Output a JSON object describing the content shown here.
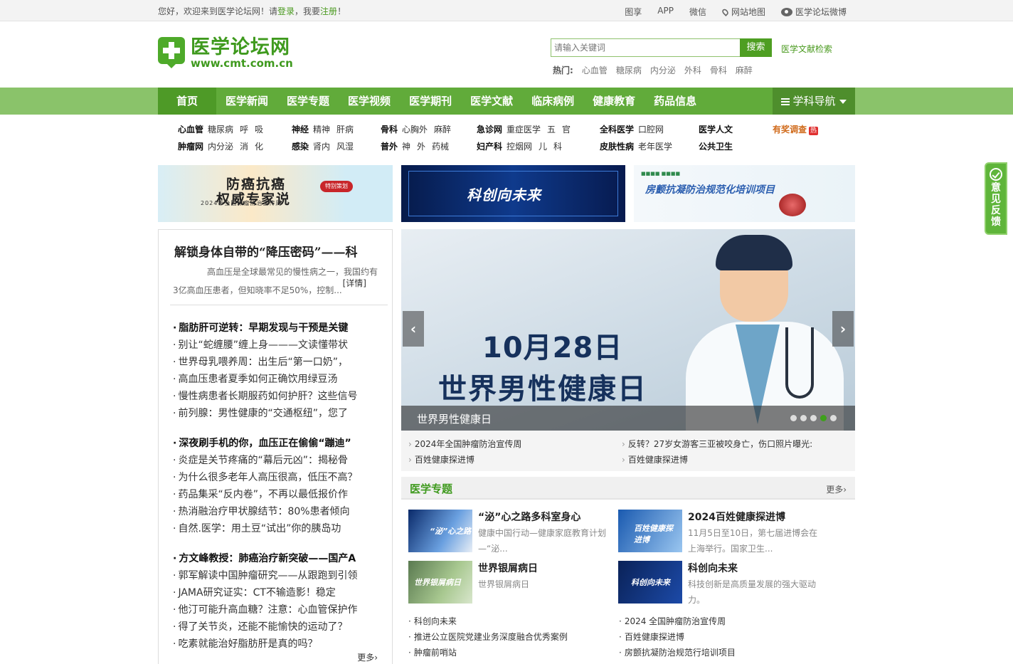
{
  "topbar": {
    "welcome_prefix": "您好，欢迎来到医学论坛网！请",
    "login": "登录",
    "mid": "，我要",
    "register": "注册",
    "suffix": "！",
    "links": [
      "图享",
      "APP",
      "微信",
      "网站地图",
      "医学论坛微博"
    ]
  },
  "header": {
    "logo_name": "医学论坛网",
    "logo_url": "www.cmt.com.cn",
    "search_placeholder": "请输入关键词",
    "search_button": "搜索",
    "literature_search": "医学文献检索",
    "hot_label": "热门:",
    "hot_terms": [
      "心血管",
      "糖尿病",
      "内分泌",
      "外科",
      "骨科",
      "麻醉"
    ]
  },
  "nav": {
    "items": [
      "首页",
      "医学新闻",
      "医学专题",
      "医学视频",
      "医学期刊",
      "医学文献",
      "临床病例",
      "健康教育",
      "药品信息"
    ],
    "subject_nav": "学科导航"
  },
  "categories": {
    "col1_row1": [
      "心血管",
      "糖尿病",
      "呼",
      "吸"
    ],
    "col1_row2": [
      "肿瘤网",
      "内分泌",
      "消",
      "化"
    ],
    "col2_row1": [
      "神经",
      "精神",
      "肝病"
    ],
    "col2_row2": [
      "感染",
      "肾内",
      "风湿"
    ],
    "col3_row1": [
      "骨科",
      "心胸外",
      "麻醉"
    ],
    "col3_row2": [
      "普外",
      "神",
      "外",
      "药械"
    ],
    "col4_row1": [
      "急诊网",
      "重症医学",
      "五",
      "官"
    ],
    "col4_row2": [
      "妇产科",
      "控烟网",
      "儿",
      "科"
    ],
    "col5_row1": [
      "全科医学",
      "口腔网"
    ],
    "col5_row2": [
      "皮肤性病",
      "老年医学"
    ],
    "col6_row1": [
      "医学人文"
    ],
    "col6_row2": [
      "公共卫生"
    ],
    "survey": "有奖调查",
    "survey_badge": "热"
  },
  "banners": {
    "b1_line1": "防癌抗癌",
    "b1_line2": "权威专家说",
    "b1_tag": "特别策划",
    "b1_sub": "2024年全国肿瘤防治宣传周",
    "b2_title": "科创向未来",
    "b3_title": "房颤抗凝防治规范化培训项目"
  },
  "feature": {
    "title": "解锁身体自带的“降压密码”——科",
    "desc": "高血压是全球最常见的慢性病之一，我国约有3亿高血压患者，但知晓率不足50%，控制...",
    "detail": "[详情]"
  },
  "news_groups": [
    [
      "脂肪肝可逆转：早期发现与干预是关键",
      "别让“蛇缠腰”缠上身———文读懂带状",
      "世界母乳喂养周：出生后“第一口奶”，",
      "高血压患者夏季如何正确饮用绿豆汤",
      "慢性病患者长期服药如何护肝？这些信号",
      "前列腺：男性健康的“交通枢纽”，您了"
    ],
    [
      "深夜刷手机的你，血压正在偷偷“蹦迪”",
      "炎症是关节疼痛的“幕后元凶”：揭秘骨",
      "为什么很多老年人高压很高，低压不高？",
      "药品集采“反内卷”，不再以最低报价作",
      "热消融治疗甲状腺结节：80%患者倾向",
      "自然.医学：用土豆“试出”你的胰岛功"
    ],
    [
      "方文峰教授：肺癌治疗新突破——国产A",
      "郭军解读中国肿瘤研究——从跟跑到引领",
      "JAMA研究证实：CT不输造影！稳定",
      "他汀可能升高血糖？注意：心血管保护作",
      "得了关节炎，还能不能愉快的运动了？",
      "吃素就能治好脂肪肝是真的吗？"
    ]
  ],
  "left_more": "更多›",
  "slider": {
    "date": "10月28日",
    "day": "世界男性健康日",
    "caption": "世界男性健康日",
    "dots": 5,
    "active_dot": 4
  },
  "quick_links": [
    "2024年全国肿瘤防治宣传周",
    "反转？27岁女游客三亚被咬身亡，伤口照片曝光:",
    "百姓健康探进博",
    "百姓健康探进博"
  ],
  "topics": {
    "title": "医学专题",
    "more": "更多›",
    "items": [
      {
        "title": "“泌”心之路多科室身心",
        "desc": "健康中国行动—健康家庭教育计划—“泌..."
      },
      {
        "title": "2024百姓健康探进博",
        "desc": "11月5日至10日，第七届进博会在上海举行。国家卫生..."
      },
      {
        "title": "世界银屑病日",
        "desc": "世界银屑病日"
      },
      {
        "title": "科创向未来",
        "desc": "科技创新是高质量发展的强大驱动力。"
      }
    ],
    "thumb_labels": [
      "“泌”心之路",
      "百姓健康探进博",
      "世界银屑病日",
      "科创向未来"
    ],
    "links_left": [
      "科创向未来",
      "推进公立医院党建业务深度融合优秀案例",
      "肿瘤前哨站"
    ],
    "links_right": [
      "2024 全国肿瘤防治宣传周",
      "百姓健康探进博",
      "房颤抗凝防治规范行培训项目"
    ]
  },
  "feedback": "意见反馈"
}
